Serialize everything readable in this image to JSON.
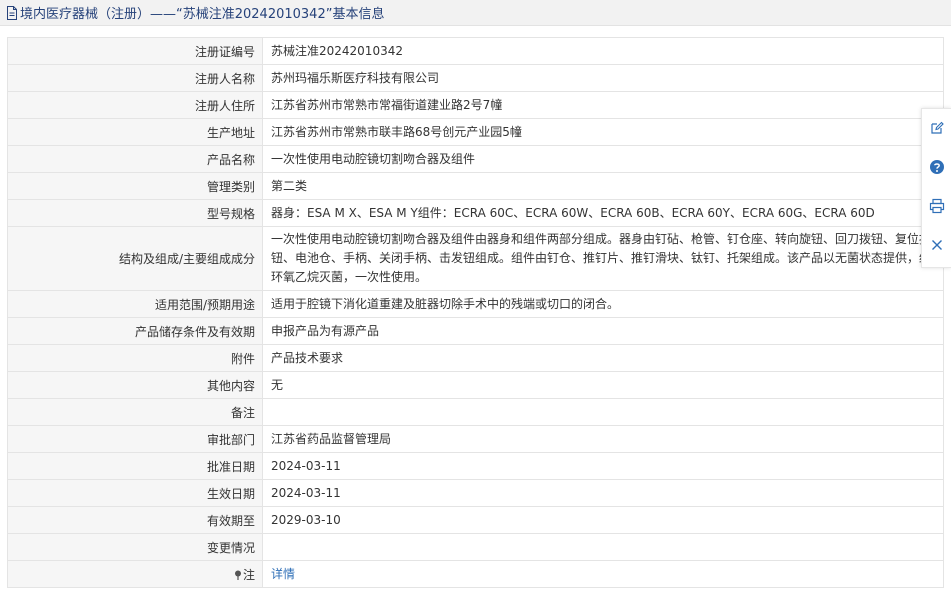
{
  "header": {
    "title": "境内医疗器械（注册）——“苏械注准20242010342”基本信息"
  },
  "rows": [
    {
      "label": "注册证编号",
      "value": "苏械注准20242010342"
    },
    {
      "label": "注册人名称",
      "value": "苏州玛福乐斯医疗科技有限公司"
    },
    {
      "label": "注册人住所",
      "value": "江苏省苏州市常熟市常福街道建业路2号7幢"
    },
    {
      "label": "生产地址",
      "value": "江苏省苏州市常熟市联丰路68号创元产业园5幢"
    },
    {
      "label": "产品名称",
      "value": "一次性使用电动腔镜切割吻合器及组件"
    },
    {
      "label": "管理类别",
      "value": "第二类"
    },
    {
      "label": "型号规格",
      "value": "器身：ESA M X、ESA M Y组件：ECRA 60C、ECRA 60W、ECRA 60B、ECRA 60Y、ECRA 60G、ECRA 60D"
    },
    {
      "label": "结构及组成/主要组成成分",
      "value": "一次性使用电动腔镜切割吻合器及组件由器身和组件两部分组成。器身由钉砧、枪管、钉仓座、转向旋钮、回刀拨钮、复位按钮、电池仓、手柄、关闭手柄、击发钮组成。组件由钉仓、推钉片、推钉滑块、钛钉、托架组成。该产品以无菌状态提供，经环氧乙烷灭菌，一次性使用。"
    },
    {
      "label": "适用范围/预期用途",
      "value": "适用于腔镜下消化道重建及脏器切除手术中的残端或切口的闭合。"
    },
    {
      "label": "产品储存条件及有效期",
      "value": "申报产品为有源产品"
    },
    {
      "label": "附件",
      "value": "产品技术要求"
    },
    {
      "label": "其他内容",
      "value": "无"
    },
    {
      "label": "备注",
      "value": ""
    },
    {
      "label": "审批部门",
      "value": "江苏省药品监督管理局"
    },
    {
      "label": "批准日期",
      "value": "2024-03-11"
    },
    {
      "label": "生效日期",
      "value": "2024-03-11"
    },
    {
      "label": "有效期至",
      "value": "2029-03-10"
    },
    {
      "label": "变更情况",
      "value": ""
    }
  ],
  "note_row": {
    "label": "注",
    "link": "详情"
  },
  "colors": {
    "header_text": "#26427a",
    "link": "#2f6fb7",
    "label_bg": "#f6f6f6"
  },
  "side_toolbar": [
    "edit-icon",
    "help-icon",
    "print-icon",
    "close-icon"
  ]
}
